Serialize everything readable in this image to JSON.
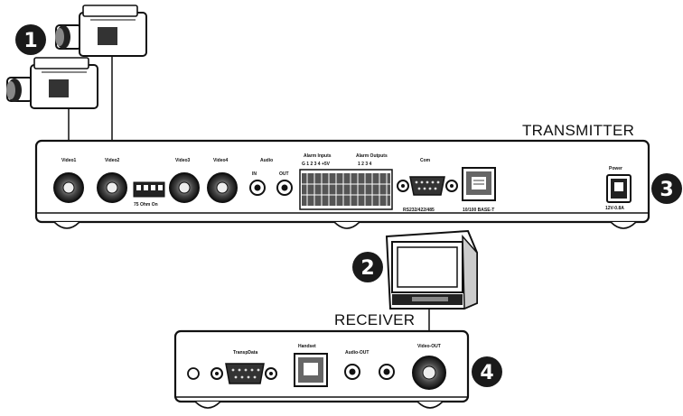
{
  "labels": {
    "transmitter": "TRANSMITTER",
    "receiver": "RECEIVER"
  },
  "callouts": [
    "1",
    "2",
    "3",
    "4"
  ],
  "transmitter_panel": {
    "video1": "Video1",
    "video2": "Video2",
    "video3": "Video3",
    "video4": "Video4",
    "ohm": "75 Ohm On",
    "audio": "Audio",
    "audio_in": "IN",
    "audio_out": "OUT",
    "alarm_inputs": "Alarm Inputs",
    "alarm_input_numbers": "G  1  2  3  4  +5V",
    "alarm_outputs": "Alarm Outputs",
    "alarm_output_numbers": "1  2  3  4",
    "com": "Com",
    "com_sub": "RS232/422/485",
    "ethernet_sub": "10/100 BASE-T",
    "power": "Power",
    "power_sub": "12V-0.8A"
  },
  "receiver_panel": {
    "transp_data": "TranspData",
    "handset": "Handset",
    "audio_out": "Audio-OUT",
    "video_out": "Video-OUT"
  },
  "colors": {
    "line": "#111111",
    "callout_fill": "#1a1a1a"
  }
}
